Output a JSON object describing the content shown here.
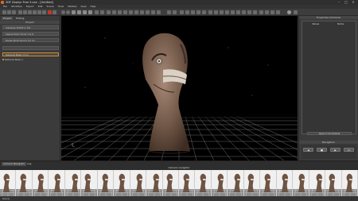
{
  "window": {
    "title": "3DF Zephyr Free 5.xxx - [Untitled]"
  },
  "menu": [
    "File",
    "Workflow",
    "Export",
    "Edit",
    "Scene",
    "Tools",
    "Utilities",
    "View",
    "Help"
  ],
  "left_panel": {
    "tabs": [
      "Project",
      "Editing"
    ],
    "header": "Project",
    "rows": [
      "Cameras (54/54 in 54)",
      "Sparse Point Cloud (14 k)",
      "Dense Point Cloud (1.0 m)",
      "",
      "Textured Mesh (3 m)"
    ],
    "tree_item": "Textured Mesh 1"
  },
  "right_panel": {
    "title": "Properties (Camera)",
    "columns": [
      "Values",
      "Name"
    ],
    "section": "Navigation",
    "button_label": "Apply to all cameras"
  },
  "bottom": {
    "tabs": [
      "Camera Navigator",
      "Log"
    ],
    "header": "Camera navigator",
    "thumb_count": 22
  },
  "status": {
    "text": "Ready"
  }
}
